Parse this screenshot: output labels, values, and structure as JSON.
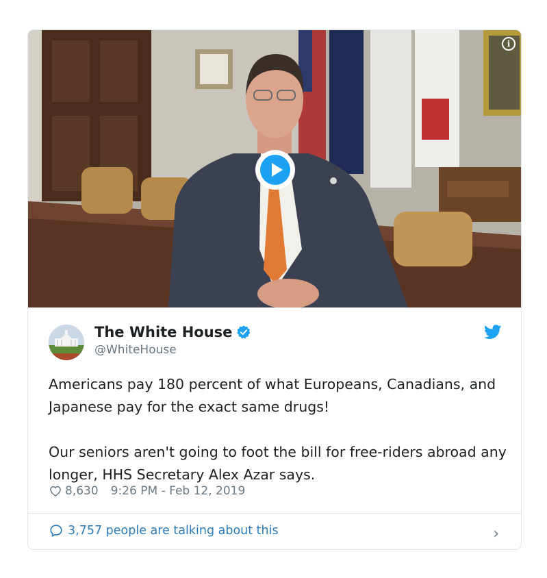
{
  "media": {
    "info_icon": "info-circle-icon",
    "play_icon": "play-icon"
  },
  "author": {
    "name": "The White House",
    "handle": "@WhiteHouse",
    "verified_icon": "verified-badge-icon",
    "avatar_icon": "white-house-avatar"
  },
  "tweet": {
    "text": "Americans pay 180 percent of what Europeans, Canadians, and Japanese pay for the exact same drugs!\n\nOur seniors aren't going to foot the bill for free-riders abroad any longer, HHS Secretary Alex Azar says."
  },
  "meta": {
    "likes": "8,630",
    "timestamp": "9:26 PM - Feb 12, 2019"
  },
  "footer": {
    "talking_text": "3,757 people are talking about this"
  },
  "colors": {
    "accent": "#1da1f2",
    "link": "#2b7bb9",
    "muted": "#697882",
    "text": "#1c2022",
    "border": "#e1e8ed"
  }
}
